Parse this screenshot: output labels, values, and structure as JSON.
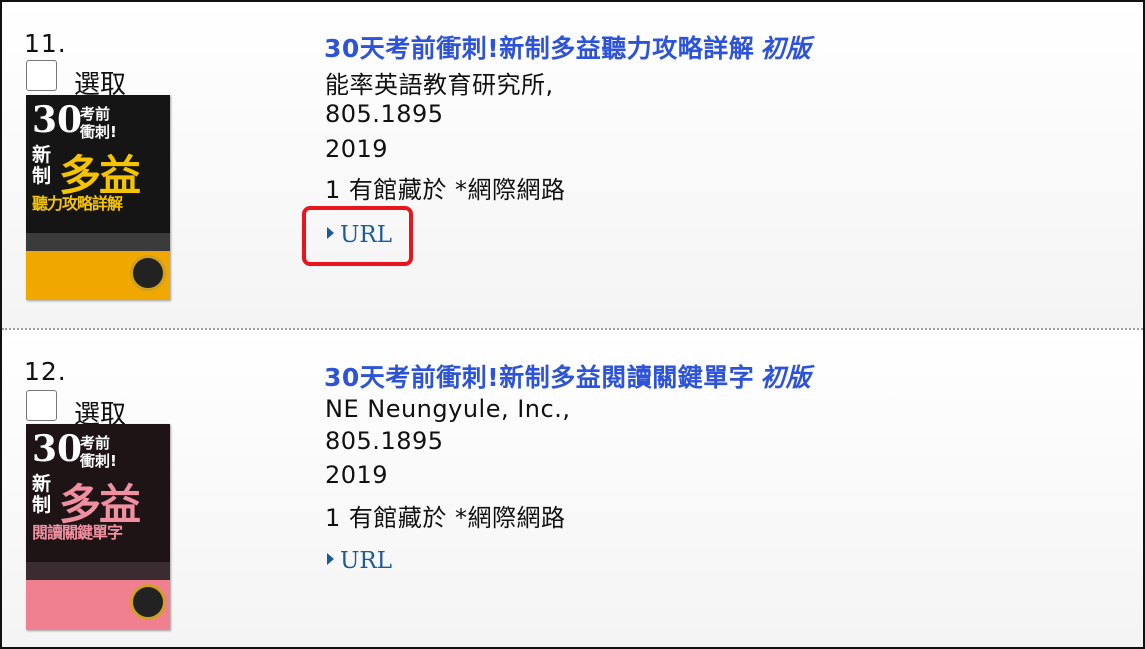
{
  "records": [
    {
      "number": "11.",
      "select_label": "選取",
      "title": "30天考前衝刺!新制多益聽力攻略詳解",
      "edition": "初版",
      "publisher": "能率英語教育研究所,",
      "call_number": "805.1895",
      "year": "2019",
      "holdings": "1 有館藏於 *網際網路",
      "link_label": "URL",
      "cover": {
        "top_text": "30",
        "tag": "考前衝刺!",
        "new": "新制",
        "brand": "多益",
        "subtitle": "聽力攻略詳解",
        "colors": {
          "background": "#151515",
          "brand": "#f5c400",
          "bottom": "#f0a800"
        }
      }
    },
    {
      "number": "12.",
      "select_label": "選取",
      "title": "30天考前衝刺!新制多益閱讀關鍵單字",
      "edition": "初版",
      "publisher": "NE Neungyule, Inc.,",
      "call_number": "805.1895",
      "year": "2019",
      "holdings": "1 有館藏於 *網際網路",
      "link_label": "URL",
      "cover": {
        "top_text": "30",
        "tag": "考前衝刺!",
        "new": "新制",
        "brand": "多益",
        "subtitle": "閱讀關鍵單字",
        "colors": {
          "background": "#1e1416",
          "brand": "#f08fa0",
          "bottom": "#f07f90"
        }
      }
    }
  ],
  "colors": {
    "title_link": "#2d53d8",
    "url_link": "#1a5c9a",
    "highlight": "#e8161c"
  }
}
